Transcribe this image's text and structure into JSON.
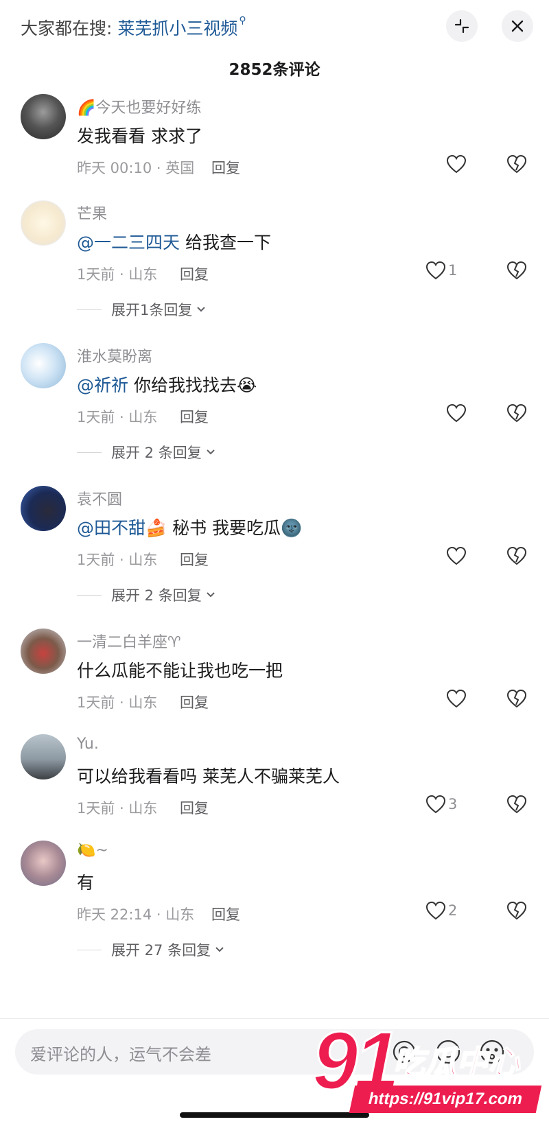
{
  "header": {
    "search_prefix": "大家都在搜:",
    "search_term": "莱芜抓小三视频"
  },
  "comment_count_title": "2852条评论",
  "comments": [
    {
      "username": "🌈今天也要好好练",
      "text": "发我看看 求求了",
      "mention": "",
      "meta": "昨天 00:10 · 英国",
      "reply_label": "回复",
      "likes": "",
      "expand": ""
    },
    {
      "username": "芒果",
      "mention": "@一二三四天",
      "text": " 给我查一下",
      "meta": "1天前 · 山东",
      "reply_label": "回复",
      "likes": "1",
      "expand": "展开1条回复"
    },
    {
      "username": "淮水莫盼离",
      "mention": "@祈祈",
      "text": " 你给我找找去😭",
      "meta": "1天前 · 山东",
      "reply_label": "回复",
      "likes": "",
      "expand": "展开 2 条回复"
    },
    {
      "username": "袁不圆",
      "mention": "@田不甜🍰",
      "text": " 秘书 我要吃瓜🌚",
      "meta": "1天前 · 山东",
      "reply_label": "回复",
      "likes": "",
      "expand": "展开 2 条回复"
    },
    {
      "username": "一清二白羊座♈",
      "mention": "",
      "text": "什么瓜能不能让我也吃一把",
      "meta": "1天前 · 山东",
      "reply_label": "回复",
      "likes": "",
      "expand": ""
    },
    {
      "username": "Yu.",
      "mention": "",
      "text": "可以给我看看吗 莱芜人不骗莱芜人",
      "meta": "1天前 · 山东",
      "reply_label": "回复",
      "likes": "3",
      "expand": ""
    },
    {
      "username": "🍋~",
      "mention": "",
      "text": "有",
      "meta": "昨天 22:14 · 山东",
      "reply_label": "回复",
      "likes": "2",
      "expand": "展开 27 条回复"
    }
  ],
  "input": {
    "placeholder": "爱评论的人，运气不会差"
  },
  "watermark": {
    "number": "91",
    "name": "吃瓜中心",
    "url": "https://91vip17.com"
  },
  "colors": {
    "mention": "#1f5a96",
    "muted": "#8e8e93",
    "watermark": "#ee1d4f"
  }
}
